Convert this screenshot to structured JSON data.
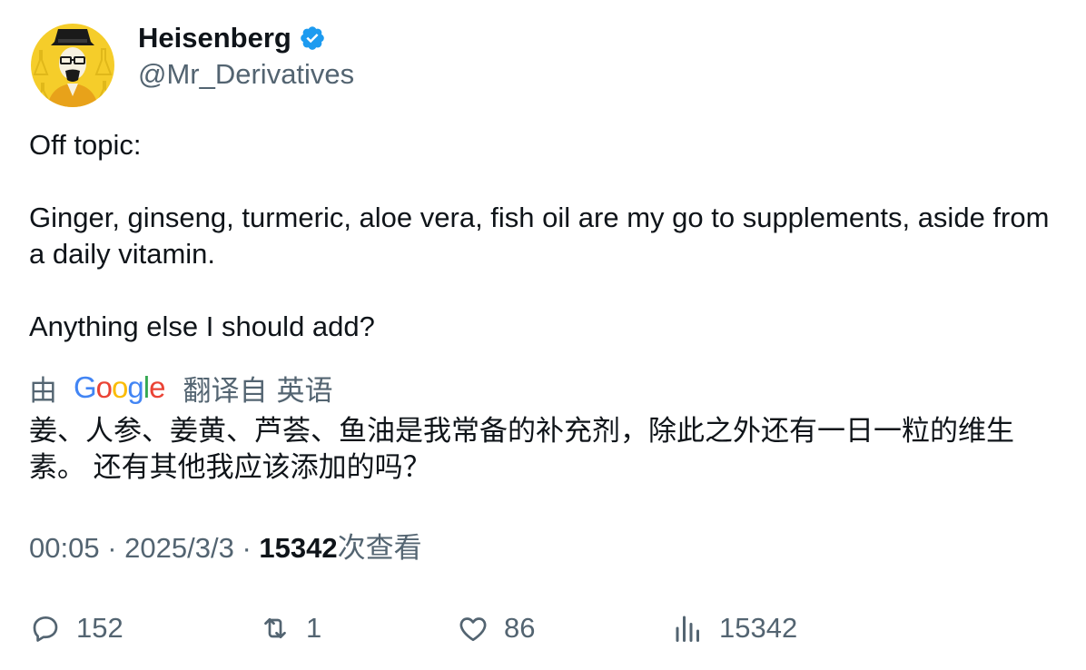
{
  "author": {
    "display_name": "Heisenberg",
    "handle": "@Mr_Derivatives",
    "verified": true,
    "avatar_icon": "heisenberg-avatar-icon",
    "verified_color": "#1d9bf0"
  },
  "tweet": {
    "paragraphs": [
      "Off topic:",
      "Ginger, ginseng, turmeric, aloe vera, fish oil are my go to supplements, aside from a daily vitamin.",
      "Anything else I should add?"
    ]
  },
  "translation": {
    "by_label": "由",
    "provider": "Google",
    "from_label": "翻译自",
    "language": "英语",
    "text": "姜、人参、姜黄、芦荟、鱼油是我常备的补充剂，除此之外还有一日一粒的维生素。 还有其他我应该添加的吗？"
  },
  "meta": {
    "time": "00:05",
    "date": "2025/3/3",
    "views_count": "15342",
    "views_label": "次查看"
  },
  "actions": {
    "replies": "152",
    "retweets": "1",
    "likes": "86",
    "views": "15342"
  },
  "colors": {
    "text_primary": "#0f1419",
    "text_secondary": "#536471",
    "google_blue": "#4285f4",
    "google_red": "#ea4335",
    "google_yellow": "#fbbc05",
    "google_green": "#34a853"
  }
}
